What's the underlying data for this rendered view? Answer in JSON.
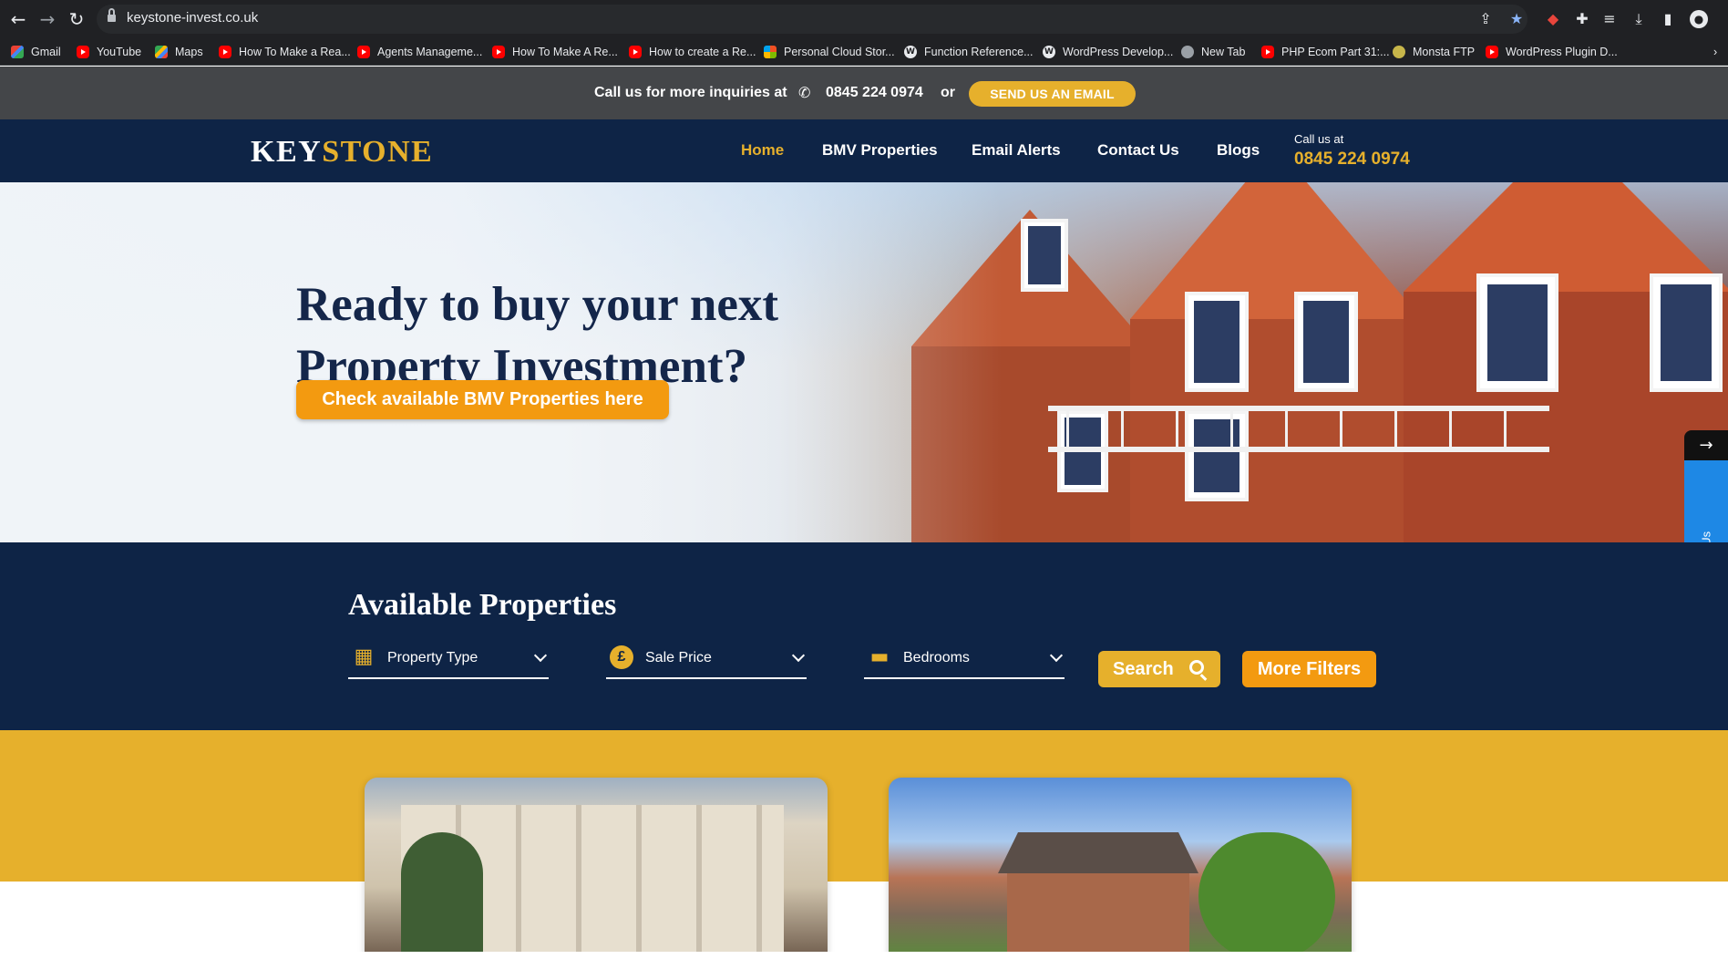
{
  "browser": {
    "url": "keystone-invest.co.uk",
    "bookmarks": [
      {
        "label": "Gmail",
        "icon": "gmail-icon"
      },
      {
        "label": "YouTube",
        "icon": "youtube-icon"
      },
      {
        "label": "Maps",
        "icon": "maps-icon"
      },
      {
        "label": "How To Make a Rea...",
        "icon": "youtube-icon"
      },
      {
        "label": "Agents Manageme...",
        "icon": "youtube-icon"
      },
      {
        "label": "How To Make A Re...",
        "icon": "youtube-icon"
      },
      {
        "label": "How to create a Re...",
        "icon": "youtube-icon"
      },
      {
        "label": "Personal Cloud Stor...",
        "icon": "microsoft-icon"
      },
      {
        "label": "Function Reference...",
        "icon": "wordpress-icon"
      },
      {
        "label": "WordPress Develop...",
        "icon": "wordpress-icon"
      },
      {
        "label": "New Tab",
        "icon": "globe-icon"
      },
      {
        "label": "PHP Ecom Part 31:...",
        "icon": "youtube-icon"
      },
      {
        "label": "Monsta FTP",
        "icon": "monsta-icon"
      },
      {
        "label": "WordPress Plugin D...",
        "icon": "youtube-icon"
      }
    ]
  },
  "topbar": {
    "inquiry_text": "Call us for more inquiries at",
    "phone": "0845 224 0974",
    "or_text": "or",
    "email_button": "SEND US AN EMAIL"
  },
  "nav": {
    "logo_part1": "KEY",
    "logo_part2": "STONE",
    "items": [
      {
        "label": "Home",
        "active": true
      },
      {
        "label": "BMV Properties",
        "active": false
      },
      {
        "label": "Email Alerts",
        "active": false
      },
      {
        "label": "Contact Us",
        "active": false
      },
      {
        "label": "Blogs",
        "active": false
      }
    ],
    "call_label": "Call us at",
    "call_number": "0845 224 0974"
  },
  "hero": {
    "title_line1": "Ready to buy your next",
    "title_line2": "Property Investment?",
    "button": "Check available BMV Properties here"
  },
  "contact_tab": {
    "label": "Contact Us",
    "arrow": "→"
  },
  "search": {
    "title": "Available Properties",
    "filters": [
      {
        "label": "Property Type",
        "icon": "building-icon"
      },
      {
        "label": "Sale Price",
        "icon": "pound-coin-icon"
      },
      {
        "label": "Bedrooms",
        "icon": "bed-icon"
      }
    ],
    "search_button": "Search",
    "more_filters_button": "More Filters"
  },
  "colors": {
    "navy": "#0e2446",
    "gold": "#e6b02c",
    "orange": "#f39a10",
    "topbar": "#444649",
    "contact_blue": "#1e88e5"
  }
}
